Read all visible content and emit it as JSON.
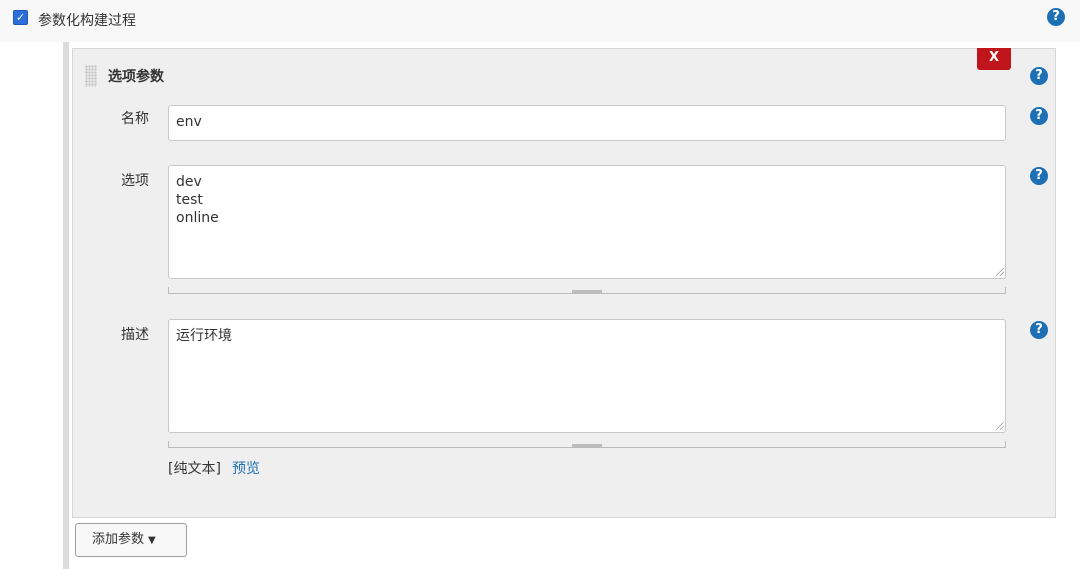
{
  "header": {
    "checkbox_checked": true,
    "checkbox_glyph": "✓",
    "label": "参数化构建过程",
    "help_glyph": "?"
  },
  "parameter": {
    "title": "选项参数",
    "delete_label": "X",
    "help_glyph": "?",
    "fields": {
      "name": {
        "label": "名称",
        "value": "env"
      },
      "choices": {
        "label": "选项",
        "value": "dev\ntest\nonline"
      },
      "description": {
        "label": "描述",
        "value": "运行环境"
      }
    },
    "format_note": "[纯文本]",
    "preview_label": "预览"
  },
  "footer": {
    "add_button_label": "添加参数",
    "add_button_caret": "▼"
  },
  "colors": {
    "accent": "#1e6fb4",
    "delete": "#c0161b",
    "card_background": "#efefef"
  },
  "icons": [
    "help-icon",
    "checkbox-icon",
    "drag-handle-icon",
    "caret-down-icon"
  ]
}
